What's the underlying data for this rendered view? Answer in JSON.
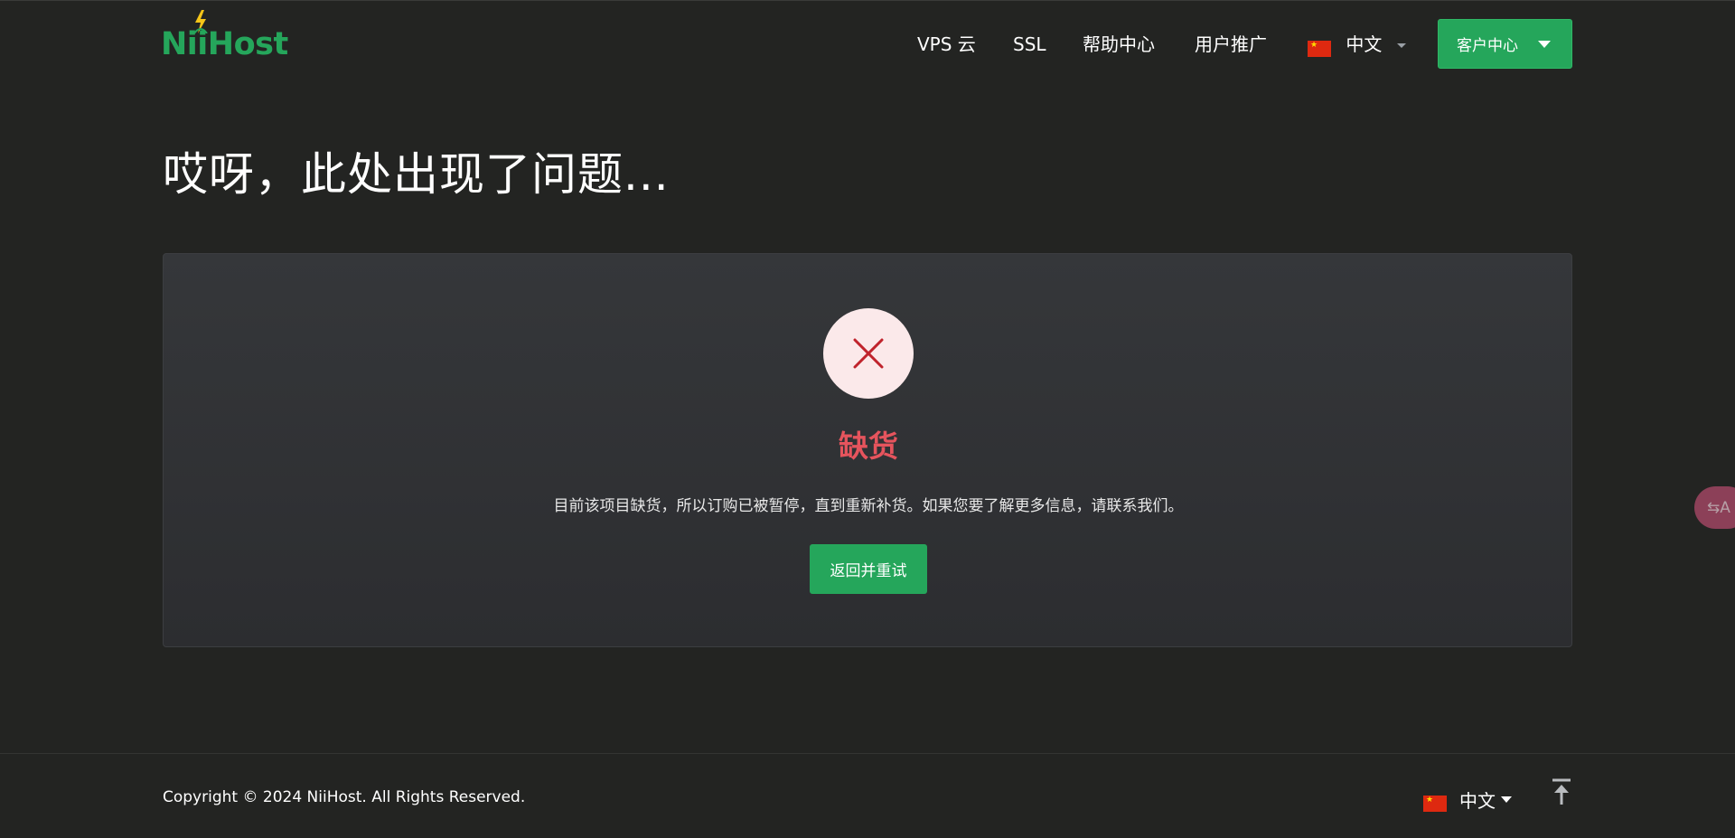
{
  "brand": {
    "name": "NiiHost",
    "color": "#25a65b"
  },
  "nav": {
    "items": [
      {
        "label": "VPS 云"
      },
      {
        "label": "SSL"
      },
      {
        "label": "帮助中心"
      },
      {
        "label": "用户推广"
      }
    ],
    "language": "中文",
    "client_center": "客户中心"
  },
  "page": {
    "title": "哎呀，此处出现了问题..."
  },
  "error": {
    "icon": "close-icon",
    "title": "缺货",
    "message": "目前该项目缺货，所以订购已被暂停，直到重新补货。如果您要了解更多信息，请联系我们。",
    "retry_label": "返回并重试",
    "accent_color": "#e6545d"
  },
  "translate_fab": {
    "icon": "translate-icon",
    "glyph": "⇆A"
  },
  "footer": {
    "copyright": "Copyright © 2024 NiiHost. All Rights Reserved.",
    "language": "中文",
    "back_to_top_icon": "arrow-up-to-line-icon"
  }
}
